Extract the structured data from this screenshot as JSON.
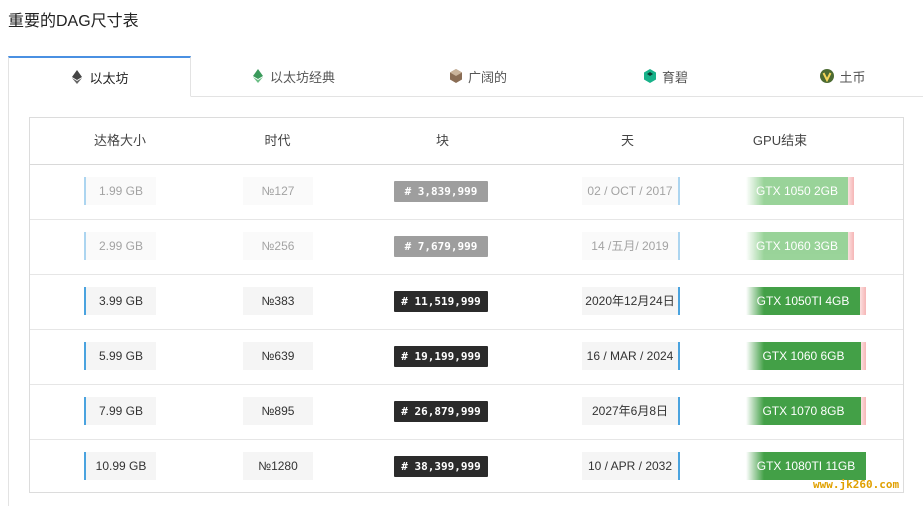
{
  "page": {
    "title": "重要的DAG尺寸表"
  },
  "tabs": [
    {
      "label": "以太坊",
      "icon": "ethereum-icon",
      "active": true
    },
    {
      "label": "以太坊经典",
      "icon": "ethereum-classic-icon",
      "active": false
    },
    {
      "label": "广阔的",
      "icon": "expanse-icon",
      "active": false
    },
    {
      "label": "育碧",
      "icon": "ubiq-icon",
      "active": false
    },
    {
      "label": "土币",
      "icon": "musicoin-icon",
      "active": false
    }
  ],
  "table": {
    "headers": {
      "size": "达格大小",
      "epoch": "时代",
      "block": "块",
      "day": "天",
      "gpu": "GPU结束"
    },
    "rows": [
      {
        "size": "1.99 GB",
        "epoch": "№127",
        "block": "#  3,839,999",
        "day": "02 / OCT / 2017",
        "gpu": "GTX 1050 2GB",
        "faded": true,
        "gpu_fill": 0.85
      },
      {
        "size": "2.99 GB",
        "epoch": "№256",
        "block": "#  7,679,999",
        "day": "14 /五月/ 2019",
        "gpu": "GTX 1060 3GB",
        "faded": true,
        "gpu_fill": 0.85
      },
      {
        "size": "3.99 GB",
        "epoch": "№383",
        "block": "# 11,519,999",
        "day": "2020年12月24日",
        "gpu": "GTX 1050TI 4GB",
        "faded": false,
        "gpu_fill": 0.95
      },
      {
        "size": "5.99 GB",
        "epoch": "№639",
        "block": "# 19,199,999",
        "day": "16 / MAR / 2024",
        "gpu": "GTX 1060 6GB",
        "faded": false,
        "gpu_fill": 0.96
      },
      {
        "size": "7.99 GB",
        "epoch": "№895",
        "block": "# 26,879,999",
        "day": "2027年6月8日",
        "gpu": "GTX 1070 8GB",
        "faded": false,
        "gpu_fill": 0.96
      },
      {
        "size": "10.99 GB",
        "epoch": "№1280",
        "block": "# 38,399,999",
        "day": "10 / APR / 2032",
        "gpu": "GTX 1080TI 11GB",
        "faded": false,
        "gpu_fill": 1.0
      }
    ]
  },
  "watermark": "www.jk260.com",
  "colors": {
    "accent": "#4a90e2",
    "gpu_green": "#43a047",
    "gpu_green_faded": "#8fcf8f",
    "block_bg": "#2b2b2b"
  }
}
